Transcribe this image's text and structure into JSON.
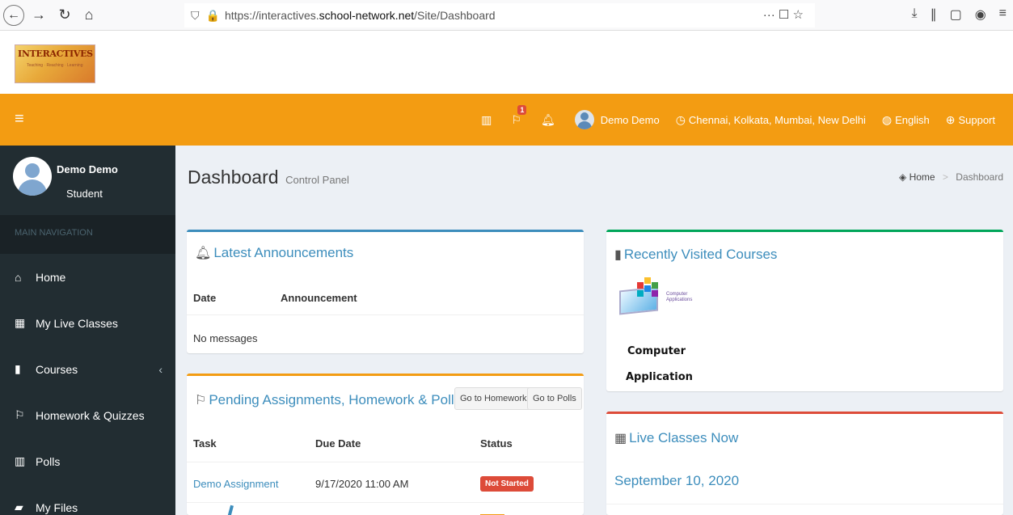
{
  "browser": {
    "back_icon": "back-arrow-icon",
    "url_prefix": "https://interactives.",
    "url_domain": "school-network.net",
    "url_path": "/Site/Dashboard"
  },
  "logo": {
    "text": "INTERACTIVES",
    "subtext": "Teaching · Reaching · Learning"
  },
  "topbar": {
    "notifications_count": "1",
    "user_name": "Demo Demo",
    "locations": "Chennai, Kolkata, Mumbai, New Delhi",
    "language": "English",
    "support": "Support"
  },
  "sidebar": {
    "user_name": "Demo Demo",
    "user_role": "Student",
    "header": "MAIN NAVIGATION",
    "items": [
      {
        "label": "Home",
        "icon": "home-icon"
      },
      {
        "label": "My Live Classes",
        "icon": "calendar-icon"
      },
      {
        "label": "Courses",
        "icon": "book-icon"
      },
      {
        "label": "Homework & Quizzes",
        "icon": "flag-icon"
      },
      {
        "label": "Polls",
        "icon": "bar-chart-icon"
      },
      {
        "label": "My Files",
        "icon": "folder-icon"
      }
    ]
  },
  "page": {
    "title": "Dashboard",
    "subtitle": "Control Panel",
    "breadcrumb_home": "Home",
    "breadcrumb_current": "Dashboard"
  },
  "announcements": {
    "title": "Latest Announcements",
    "col_date": "Date",
    "col_announcement": "Announcement",
    "empty": "No messages"
  },
  "assignments": {
    "title": "Pending Assignments, Homework & Polls",
    "btn_homework": "Go to Homework",
    "btn_polls": "Go to Polls",
    "col_task": "Task",
    "col_due": "Due Date",
    "col_status": "Status",
    "rows": [
      {
        "task": "Demo Assignment",
        "due": "9/17/2020 11:00 AM",
        "status": "Not Started"
      }
    ]
  },
  "recent_courses": {
    "title": "Recently Visited Courses",
    "thumb_text": "Computer Applications",
    "course_line1": "Computer",
    "course_line2": "Application"
  },
  "live_classes": {
    "title": "Live Classes Now",
    "date": "September 10, 2020"
  },
  "colors": {
    "accent_orange": "#f39c12",
    "sidebar_bg": "#222d32",
    "link_blue": "#3c8dbc",
    "danger_red": "#dd4b39",
    "success_green": "#00a65a"
  }
}
